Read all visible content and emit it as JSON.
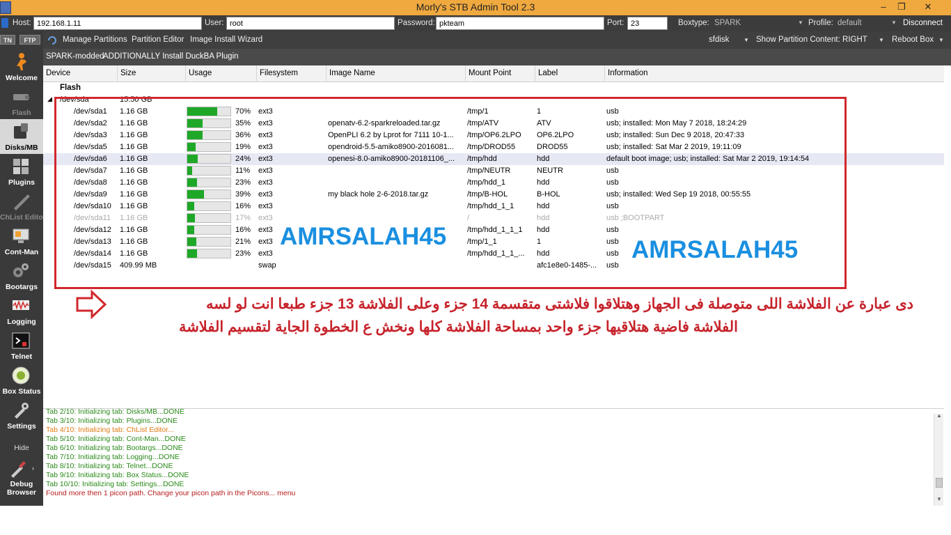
{
  "window": {
    "title": "Morly's STB Admin Tool 2.3",
    "controls": [
      "–",
      "❐",
      "✕"
    ]
  },
  "connection": {
    "host_label": "Host:",
    "host_value": "192.168.1.11",
    "user_label": "User:",
    "user_value": "root",
    "password_label": "Password:",
    "password_value": "pkteam",
    "port_label": "Port:",
    "port_value": "23",
    "boxtype_label": "Boxtype:",
    "boxtype_value": "SPARK",
    "profile_label": "Profile:",
    "profile_value": "default",
    "disconnect_label": "Disconnect"
  },
  "sidebar": {
    "tn_label": "TN",
    "ftp_label": "FTP",
    "items": [
      {
        "label": "Welcome"
      },
      {
        "label": "Flash"
      },
      {
        "label": "Disks/MB"
      },
      {
        "label": "Plugins"
      },
      {
        "label": "ChList Editor"
      },
      {
        "label": "Cont-Man"
      },
      {
        "label": "Bootargs"
      },
      {
        "label": "Logging"
      },
      {
        "label": "Telnet"
      },
      {
        "label": "Box Status"
      },
      {
        "label": "Settings"
      }
    ],
    "hide_label": "Hide",
    "debug_label_1": "Debug",
    "debug_label_2": "Browser"
  },
  "toolbar": {
    "manage_partitions": "Manage Partitions",
    "partition_editor": "Partition Editor",
    "image_install_wizard": "Image Install Wizard",
    "sfdisk": "sfdisk",
    "show_partition_content": "Show Partition Content: RIGHT",
    "reboot_box": "Reboot Box"
  },
  "subbar": {
    "item1": "SPARK-modded",
    "item2": "ADDITIONALLY Install DuckBA Plugin"
  },
  "table": {
    "headers": [
      "Device",
      "Size",
      "Usage",
      "Filesystem",
      "Image Name",
      "Mount Point",
      "Label",
      "Information"
    ],
    "group": "Flash",
    "root_device": "/dev/sda",
    "root_size": "15.50 GB",
    "rows": [
      {
        "device": "/dev/sda1",
        "size": "1.16 GB",
        "usage": 70,
        "usage_text": "70%",
        "fs": "ext3",
        "image": "",
        "mount": "/tmp/1",
        "label": "1",
        "info": "usb"
      },
      {
        "device": "/dev/sda2",
        "size": "1.16 GB",
        "usage": 35,
        "usage_text": "35%",
        "fs": "ext3",
        "image": "openatv-6.2-sparkreloaded.tar.gz",
        "mount": "/tmp/ATV",
        "label": "ATV",
        "info": "usb; installed: Mon May 7 2018, 18:24:29"
      },
      {
        "device": "/dev/sda3",
        "size": "1.16 GB",
        "usage": 36,
        "usage_text": "36%",
        "fs": "ext3",
        "image": "OpenPLI 6.2 by Lprot for 7111 10-1...",
        "mount": "/tmp/OP6.2LPO",
        "label": "OP6.2LPO",
        "info": "usb; installed: Sun Dec 9 2018, 20:47:33"
      },
      {
        "device": "/dev/sda5",
        "size": "1.16 GB",
        "usage": 19,
        "usage_text": "19%",
        "fs": "ext3",
        "image": "opendroid-5.5-amiko8900-2016081...",
        "mount": "/tmp/DROD55",
        "label": "DROD55",
        "info": "usb; installed: Sat Mar 2 2019, 19:11:09"
      },
      {
        "device": "/dev/sda6",
        "size": "1.16 GB",
        "usage": 24,
        "usage_text": "24%",
        "fs": "ext3",
        "image": "openesi-8.0-amiko8900-20181106_...",
        "mount": "/tmp/hdd",
        "label": "hdd",
        "info": "default boot image; usb; installed: Sat Mar 2 2019, 19:14:54",
        "selected": true
      },
      {
        "device": "/dev/sda7",
        "size": "1.16 GB",
        "usage": 11,
        "usage_text": "11%",
        "fs": "ext3",
        "image": "",
        "mount": "/tmp/NEUTR",
        "label": "NEUTR",
        "info": "usb"
      },
      {
        "device": "/dev/sda8",
        "size": "1.16 GB",
        "usage": 23,
        "usage_text": "23%",
        "fs": "ext3",
        "image": "",
        "mount": "/tmp/hdd_1",
        "label": "hdd",
        "info": "usb"
      },
      {
        "device": "/dev/sda9",
        "size": "1.16 GB",
        "usage": 39,
        "usage_text": "39%",
        "fs": "ext3",
        "image": "my black hole 2-6-2018.tar.gz",
        "mount": "/tmp/B-HOL",
        "label": "B-HOL",
        "info": "usb; installed: Wed Sep 19 2018, 00:55:55"
      },
      {
        "device": "/dev/sda10",
        "size": "1.16 GB",
        "usage": 16,
        "usage_text": "16%",
        "fs": "ext3",
        "image": "",
        "mount": "/tmp/hdd_1_1",
        "label": "hdd",
        "info": "usb"
      },
      {
        "device": "/dev/sda11",
        "size": "1.16 GB",
        "usage": 17,
        "usage_text": "17%",
        "fs": "ext3",
        "image": "",
        "mount": "/",
        "label": "hdd",
        "info": "usb ;BOOTPART",
        "dim": true
      },
      {
        "device": "/dev/sda12",
        "size": "1.16 GB",
        "usage": 16,
        "usage_text": "16%",
        "fs": "ext3",
        "image": "",
        "mount": "/tmp/hdd_1_1_1",
        "label": "hdd",
        "info": "usb"
      },
      {
        "device": "/dev/sda13",
        "size": "1.16 GB",
        "usage": 21,
        "usage_text": "21%",
        "fs": "ext3",
        "image": "",
        "mount": "/tmp/1_1",
        "label": "1",
        "info": "usb"
      },
      {
        "device": "/dev/sda14",
        "size": "1.16 GB",
        "usage": 23,
        "usage_text": "23%",
        "fs": "ext3",
        "image": "",
        "mount": "/tmp/hdd_1_1_...",
        "label": "hdd",
        "info": "usb"
      },
      {
        "device": "/dev/sda15",
        "size": "409.99 MB",
        "usage": null,
        "usage_text": "",
        "fs": "swap",
        "image": "",
        "mount": "",
        "label": "afc1e8e0-1485-...",
        "info": "usb"
      }
    ]
  },
  "annotations": {
    "watermark1": "AMRSALAH45",
    "watermark2": "AMRSALAH45",
    "note_line1": "دى عبارة عن الفلاشة اللى متوصلة فى الجهاز وهتلاقوا فلاشتى متقسمة 14 جزء وعلى الفلاشة 13 جزء طبعا انت لو لسه",
    "note_line2": "الفلاشة فاضية  هتلاقيها جزء واحد بمساحة الفلاشة كلها ونخش ع الخطوة الجاية لتقسيم الفلاشة",
    "colors": {
      "box": "#d0282e",
      "watermark": "#1a8fe0",
      "note": "#c6232b"
    }
  },
  "log": {
    "lines": [
      {
        "text": "Tab 2/10: Initializing tab: Disks/MB...DONE",
        "color": "#2a8a1a"
      },
      {
        "text": "Tab 3/10: Initializing tab: Plugins...DONE",
        "color": "#2a8a1a"
      },
      {
        "text": "Tab 4/10: Initializing tab: ChList Editor...",
        "color": "#e07a14"
      },
      {
        "text": "Tab 5/10: Initializing tab: Cont-Man...DONE",
        "color": "#2a8a1a"
      },
      {
        "text": "Tab 6/10: Initializing tab: Bootargs...DONE",
        "color": "#2a8a1a"
      },
      {
        "text": "Tab 7/10: Initializing tab: Logging...DONE",
        "color": "#2a8a1a"
      },
      {
        "text": "Tab 8/10: Initializing tab: Telnet...DONE",
        "color": "#2a8a1a"
      },
      {
        "text": "Tab 9/10: Initializing tab: Box Status...DONE",
        "color": "#2a8a1a"
      },
      {
        "text": "Tab 10/10: Initializing tab: Settings...DONE",
        "color": "#2a8a1a"
      },
      {
        "text": "Found more then 1 picon path. Change your picon path in the Picons... menu",
        "color": "#b81c1c"
      }
    ]
  }
}
